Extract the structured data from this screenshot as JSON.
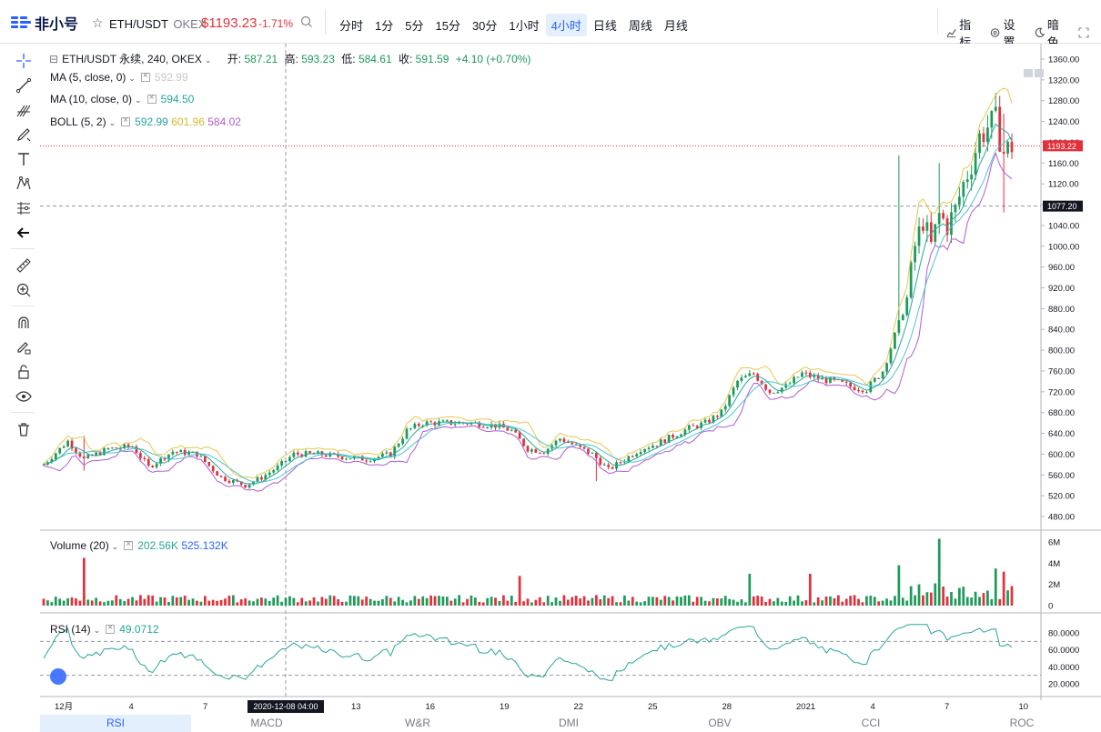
{
  "header": {
    "brand": "非小号",
    "symbol": "ETH/USDT",
    "exchange": "OKEX",
    "price": "$1193.23",
    "change": "-1.71%",
    "intervals": [
      "分时",
      "1分",
      "5分",
      "15分",
      "30分",
      "1小时",
      "4小时",
      "日线",
      "周线",
      "月线"
    ],
    "active_interval": "4小时",
    "indicators_label": "指标",
    "settings_label": "设置",
    "theme_label": "暗色"
  },
  "legend": {
    "main_title": "ETH/USDT 永续, 240, OKEX",
    "open_label": "开:",
    "open": "587.21",
    "high_label": "高:",
    "high": "593.23",
    "low_label": "低:",
    "low": "584.61",
    "close_label": "收:",
    "close": "591.59",
    "delta": "+4.10 (+0.70%)",
    "ma5_label": "MA (5, close, 0)",
    "ma5_value": "592.99",
    "ma10_label": "MA (10, close, 0)",
    "ma10_value": "594.50",
    "boll_label": "BOLL (5, 2)",
    "boll_mid": "592.99",
    "boll_up": "601.96",
    "boll_low": "584.02",
    "vol_label": "Volume (20)",
    "vol_value": "202.56K",
    "vol_ma": "525.132K",
    "rsi_label": "RSI (14)",
    "rsi_value": "49.0712"
  },
  "price_axis": [
    "1360.00",
    "1320.00",
    "1280.00",
    "1240.00",
    "1200.00",
    "1160.00",
    "1120.00",
    "1080.00",
    "1040.00",
    "1000.00",
    "960.00",
    "920.00",
    "880.00",
    "840.00",
    "800.00",
    "760.00",
    "720.00",
    "680.00",
    "640.00",
    "600.00",
    "560.00",
    "520.00",
    "480.00"
  ],
  "price_tag": "1193.22",
  "cross_tag": "1077.20",
  "volume_axis": [
    "6M",
    "4M",
    "2M",
    "0"
  ],
  "rsi_axis": [
    "80.0000",
    "60.0000",
    "40.0000",
    "20.0000"
  ],
  "time_axis": [
    "12月",
    "4",
    "7",
    "10",
    "13",
    "16",
    "19",
    "22",
    "25",
    "28",
    "2021",
    "4",
    "7",
    "10"
  ],
  "time_tag": "2020-12-08  04:00",
  "bottom_tabs": [
    "RSI",
    "MACD",
    "W&R",
    "DMI",
    "OBV",
    "CCI",
    "ROC"
  ],
  "active_tab": "RSI",
  "colors": {
    "up": "#1e9a5a",
    "down": "#e2313b",
    "ma_teal": "#26a69a",
    "boll_up": "#e6c84a",
    "boll_low": "#b05cd6",
    "accent": "#2962ff"
  },
  "chart_data": {
    "type": "candlestick",
    "title": "ETH/USDT 永续, 240, OKEX",
    "ylim": [
      460,
      1370
    ],
    "close_waypoints": [
      [
        0,
        580
      ],
      [
        6,
        625
      ],
      [
        10,
        590
      ],
      [
        16,
        610
      ],
      [
        22,
        615
      ],
      [
        26,
        575
      ],
      [
        32,
        605
      ],
      [
        38,
        600
      ],
      [
        44,
        555
      ],
      [
        50,
        540
      ],
      [
        54,
        555
      ],
      [
        58,
        575
      ],
      [
        62,
        600
      ],
      [
        68,
        600
      ],
      [
        74,
        595
      ],
      [
        80,
        590
      ],
      [
        86,
        600
      ],
      [
        90,
        645
      ],
      [
        94,
        660
      ],
      [
        100,
        660
      ],
      [
        106,
        660
      ],
      [
        112,
        655
      ],
      [
        116,
        645
      ],
      [
        120,
        610
      ],
      [
        124,
        605
      ],
      [
        128,
        630
      ],
      [
        132,
        615
      ],
      [
        136,
        600
      ],
      [
        140,
        570
      ],
      [
        144,
        590
      ],
      [
        148,
        610
      ],
      [
        152,
        620
      ],
      [
        156,
        635
      ],
      [
        160,
        650
      ],
      [
        164,
        660
      ],
      [
        168,
        680
      ],
      [
        172,
        740
      ],
      [
        176,
        755
      ],
      [
        180,
        720
      ],
      [
        184,
        730
      ],
      [
        188,
        755
      ],
      [
        192,
        745
      ],
      [
        196,
        740
      ],
      [
        200,
        730
      ],
      [
        204,
        725
      ],
      [
        208,
        760
      ],
      [
        212,
        850
      ],
      [
        214,
        900
      ],
      [
        216,
        1000
      ],
      [
        218,
        1050
      ],
      [
        220,
        1000
      ],
      [
        222,
        1060
      ],
      [
        224,
        1040
      ],
      [
        226,
        1070
      ],
      [
        228,
        1120
      ],
      [
        230,
        1160
      ],
      [
        232,
        1210
      ],
      [
        234,
        1230
      ],
      [
        236,
        1240
      ],
      [
        238,
        1180
      ],
      [
        240,
        1193
      ]
    ],
    "volume_scale_max": 7000000,
    "rsi_range": [
      20,
      90
    ],
    "rsi_levels": [
      70,
      30
    ]
  }
}
